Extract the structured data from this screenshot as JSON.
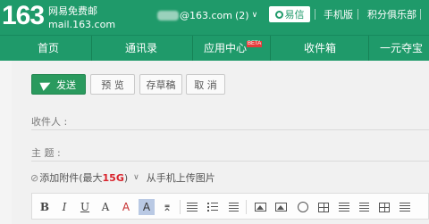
{
  "header": {
    "logo_number": "163",
    "logo_text": "网易免费邮",
    "logo_url": "mail.163.com",
    "account_domain": "@163.com",
    "account_count": "(2)",
    "yixin_label": "易信",
    "mobile_label": "手机版",
    "club_label": "积分俱乐部"
  },
  "nav": {
    "items": [
      "首页",
      "通讯录",
      "应用中心",
      "收件箱",
      "一元夺宝"
    ],
    "beta_badge": "BETA"
  },
  "compose": {
    "toolbar_buttons": {
      "send": "发送",
      "preview": "预 览",
      "save_draft": "存草稿",
      "cancel": "取 消"
    },
    "recipient_label": "收件人 :",
    "subject_label": "主   题 :",
    "attach": {
      "label": "添加附件",
      "limit_prefix": "(最大",
      "limit_value": "15G",
      "limit_suffix": ")",
      "mobile_upload": "从手机上传图片"
    }
  },
  "editor_toolbar": {
    "bold": "B",
    "italic": "I",
    "underline": "U",
    "font_size": "A",
    "font_color": "A",
    "highlight": "A"
  },
  "colors": {
    "brand": "#1f9a6a",
    "send_button": "#2a9a5e",
    "limit_red": "#d9232c"
  }
}
